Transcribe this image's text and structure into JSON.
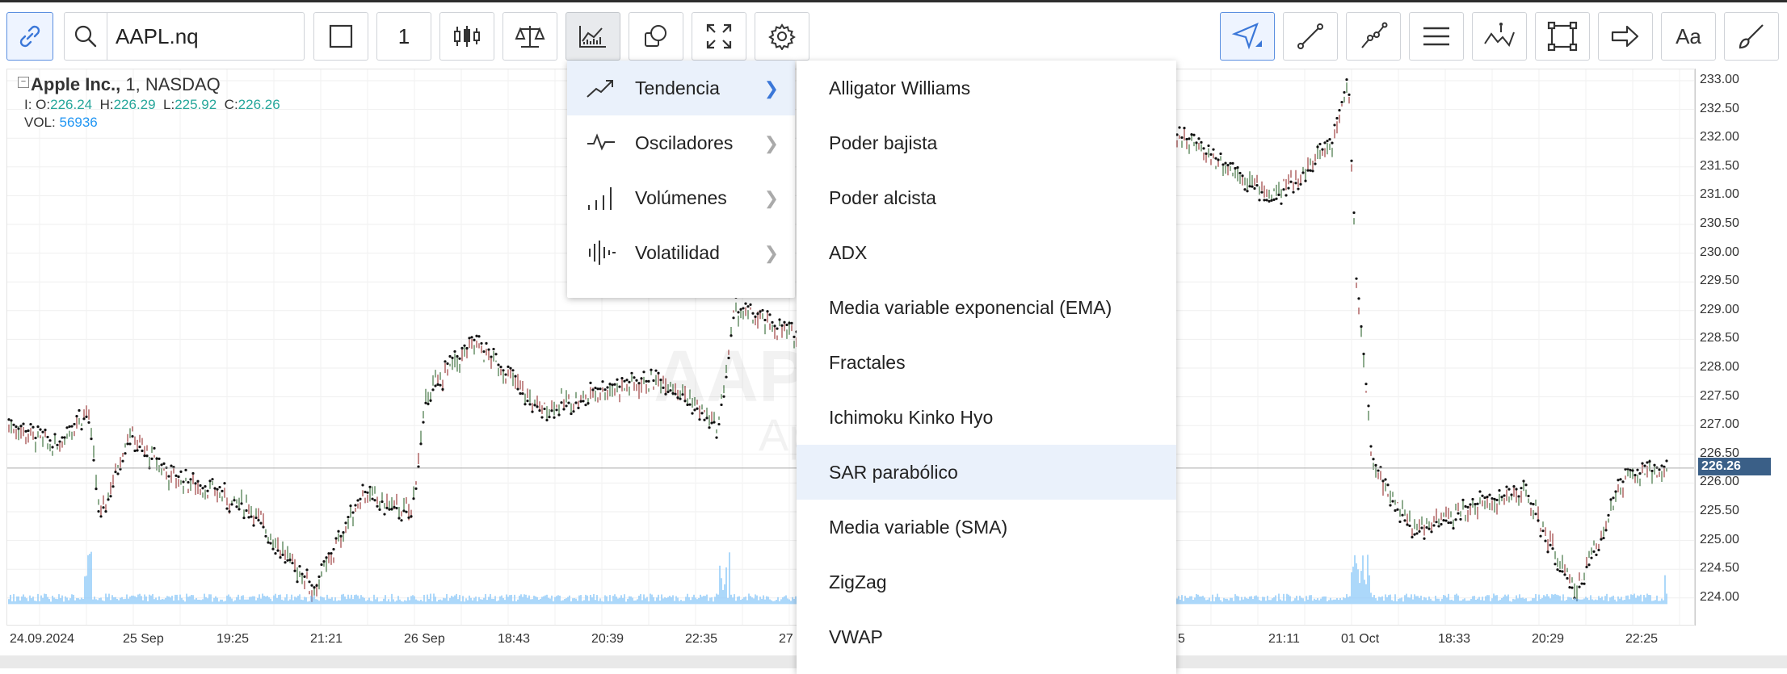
{
  "toolbar": {
    "symbol": "AAPL.nq",
    "interval": "1",
    "font_label": "Aa"
  },
  "legend": {
    "name": "Apple Inc.,",
    "interval": "1,",
    "exchange": "NASDAQ",
    "o_label": "I: O:",
    "o": "226.24",
    "h_label": "H:",
    "h": "226.29",
    "l_label": "L:",
    "l": "225.92",
    "c_label": "C:",
    "c": "226.26",
    "vol_label": "VOL:",
    "vol": "56936"
  },
  "watermark": {
    "symbol": "AAPL",
    "name": "Apple Inc."
  },
  "price_axis": [
    "233.00",
    "232.50",
    "232.00",
    "231.50",
    "231.00",
    "230.50",
    "230.00",
    "229.50",
    "229.00",
    "228.50",
    "228.00",
    "227.50",
    "227.00",
    "226.50",
    "226.00",
    "225.50",
    "225.00",
    "224.50",
    "224.00"
  ],
  "last_price": "226.26",
  "time_axis": [
    "24.09.2024",
    "25 Sep",
    "19:25",
    "21:21",
    "26 Sep",
    "18:43",
    "20:39",
    "22:35",
    "27",
    "5",
    "21:11",
    "01 Oct",
    "18:33",
    "20:29",
    "22:25"
  ],
  "indicator_categories": [
    {
      "label": "Tendencia",
      "icon": "trend-icon"
    },
    {
      "label": "Osciladores",
      "icon": "oscillator-icon"
    },
    {
      "label": "Volúmenes",
      "icon": "volume-icon"
    },
    {
      "label": "Volatilidad",
      "icon": "volatility-icon"
    }
  ],
  "trend_indicators": [
    "Alligator Williams",
    "Poder bajista",
    "Poder alcista",
    "ADX",
    "Media variable exponencial (EMA)",
    "Fractales",
    "Ichimoku Kinko Hyo",
    "SAR parabólico",
    "Media variable (SMA)",
    "ZigZag",
    "VWAP"
  ],
  "colors": {
    "accent": "#3b77d8",
    "up": "#26a69a",
    "candle_down": "#8b1a1a",
    "candle_up": "#1e5a1e",
    "volume": "#90caf9",
    "price_box": "#3a5f87"
  }
}
